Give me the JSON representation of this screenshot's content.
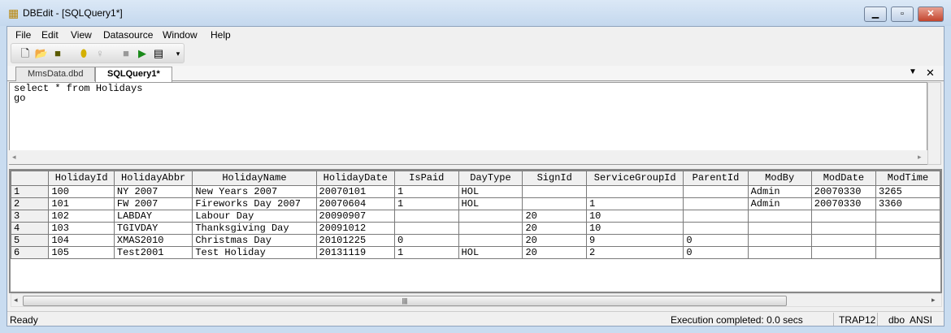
{
  "window": {
    "title": "DBEdit - [SQLQuery1*]",
    "app_icon": "database-app-icon",
    "buttons": [
      "minimize",
      "maximize",
      "close"
    ]
  },
  "menu": [
    "File",
    "Edit",
    "View",
    "Datasource",
    "Window",
    "Help"
  ],
  "toolbar": {
    "icons": [
      "new-file-icon",
      "open-folder-icon",
      "save-icon",
      "datasource-icon",
      "connect-icon",
      "stop-icon",
      "run-icon",
      "results-icon"
    ],
    "run_color": "#1a8a1a"
  },
  "tabs": [
    {
      "label": "MmsData.dbd",
      "active": false
    },
    {
      "label": "SQLQuery1*",
      "active": true
    }
  ],
  "editor": {
    "text": "select * from Holidays\ngo"
  },
  "grid": {
    "columns": [
      "",
      "HolidayId",
      "HolidayAbbr",
      "HolidayName",
      "HolidayDate",
      "IsPaid",
      "DayType",
      "SignId",
      "ServiceGroupId",
      "ParentId",
      "ModBy",
      "ModDate",
      "ModTime"
    ],
    "rows": [
      [
        "1",
        "100",
        "NY 2007",
        "New Years 2007",
        "20070101",
        "1",
        "HOL",
        "",
        "",
        "",
        "Admin",
        "20070330",
        "3265"
      ],
      [
        "2",
        "101",
        "FW 2007",
        "Fireworks Day 2007",
        "20070604",
        "1",
        "HOL",
        "",
        "1",
        "",
        "Admin",
        "20070330",
        "3360"
      ],
      [
        "3",
        "102",
        "LABDAY",
        "Labour Day",
        "20090907",
        "",
        "",
        "20",
        "10",
        "",
        "",
        "",
        ""
      ],
      [
        "4",
        "103",
        "TGIVDAY",
        "Thanksgiving Day",
        "20091012",
        "",
        "",
        "20",
        "10",
        "",
        "",
        "",
        ""
      ],
      [
        "5",
        "104",
        "XMAS2010",
        "Christmas Day",
        "20101225",
        "0",
        "",
        "20",
        "9",
        "0",
        "",
        "",
        ""
      ],
      [
        "6",
        "105",
        "Test2001",
        "Test Holiday",
        "20131119",
        "1",
        "HOL",
        "20",
        "2",
        "0",
        "",
        "",
        ""
      ]
    ]
  },
  "status": {
    "left": "Ready",
    "execution": "Execution completed: 0.0 secs",
    "server": "TRAP12",
    "schema": "dbo",
    "encoding": "ANSI"
  }
}
